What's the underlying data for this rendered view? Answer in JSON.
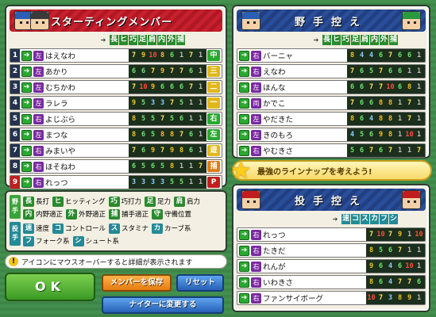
{
  "starting": {
    "title": "スターティングメンバー",
    "headers": [
      "長",
      "ヒ",
      "巧",
      "足",
      "肩",
      "内",
      "外",
      "捕"
    ],
    "rows": [
      {
        "num": "1",
        "hand": "左",
        "name": "はえなわ",
        "stats": [
          "7",
          "9",
          "10",
          "8",
          "6",
          "1",
          "7",
          "1"
        ],
        "pos": "中",
        "pos_color": "#2aa830"
      },
      {
        "num": "2",
        "hand": "左",
        "name": "あかり",
        "stats": [
          "6",
          "6",
          "7",
          "9",
          "7",
          "7",
          "6",
          "1"
        ],
        "pos": "三",
        "pos_color": "#e0b81a"
      },
      {
        "num": "3",
        "hand": "左",
        "name": "むちかわ",
        "stats": [
          "7",
          "10",
          "9",
          "6",
          "6",
          "6",
          "7",
          "1"
        ],
        "pos": "二",
        "pos_color": "#e0b81a"
      },
      {
        "num": "4",
        "hand": "左",
        "name": "ラレラ",
        "stats": [
          "9",
          "5",
          "3",
          "3",
          "7",
          "5",
          "1",
          "1"
        ],
        "pos": "一",
        "pos_color": "#e0b81a"
      },
      {
        "num": "5",
        "hand": "右",
        "name": "よじぶら",
        "stats": [
          "8",
          "5",
          "5",
          "7",
          "5",
          "6",
          "1",
          "1"
        ],
        "pos": "右",
        "pos_color": "#2aa830"
      },
      {
        "num": "6",
        "hand": "左",
        "name": "まつな",
        "stats": [
          "8",
          "6",
          "5",
          "8",
          "8",
          "7",
          "6",
          "1"
        ],
        "pos": "左",
        "pos_color": "#2aa830"
      },
      {
        "num": "7",
        "hand": "右",
        "name": "みまいや",
        "stats": [
          "7",
          "6",
          "9",
          "7",
          "9",
          "8",
          "6",
          "1"
        ],
        "pos": "遊",
        "pos_color": "#e0b81a"
      },
      {
        "num": "8",
        "hand": "右",
        "name": "ほそねわ",
        "stats": [
          "6",
          "5",
          "6",
          "5",
          "8",
          "1",
          "1",
          "7"
        ],
        "pos": "捕",
        "pos_color": "#e07a10"
      },
      {
        "num": "9",
        "hand": "右",
        "name": "れっつ",
        "stats": [
          "3",
          "3",
          "3",
          "3",
          "5",
          "5",
          "1",
          "1"
        ],
        "pos": "P",
        "pos_color": "#c01e1e"
      }
    ]
  },
  "bench": {
    "title": "野手控え",
    "headers": [
      "長",
      "ヒ",
      "巧",
      "足",
      "肩",
      "内",
      "外",
      "捕"
    ],
    "rows": [
      {
        "hand": "右",
        "name": "バーニャ",
        "stats": [
          "8",
          "4",
          "4",
          "6",
          "7",
          "6",
          "6",
          "1"
        ]
      },
      {
        "hand": "右",
        "name": "えなわ",
        "stats": [
          "7",
          "6",
          "5",
          "7",
          "6",
          "6",
          "1",
          "1"
        ]
      },
      {
        "hand": "左",
        "name": "ほんな",
        "stats": [
          "6",
          "6",
          "7",
          "7",
          "10",
          "6",
          "8",
          "1"
        ]
      },
      {
        "hand": "両",
        "name": "かでこ",
        "stats": [
          "7",
          "6",
          "6",
          "8",
          "8",
          "1",
          "7",
          "1"
        ]
      },
      {
        "hand": "左",
        "name": "やだきた",
        "stats": [
          "8",
          "6",
          "4",
          "8",
          "8",
          "1",
          "7",
          "1"
        ]
      },
      {
        "hand": "左",
        "name": "きのもろ",
        "stats": [
          "4",
          "5",
          "6",
          "9",
          "8",
          "1",
          "10",
          "1"
        ]
      },
      {
        "hand": "右",
        "name": "やむきさ",
        "stats": [
          "5",
          "6",
          "7",
          "6",
          "7",
          "1",
          "1",
          "7"
        ]
      }
    ]
  },
  "banner": "最強のラインナップを考えよう!",
  "pitchers": {
    "title": "投手控え",
    "headers": [
      "速",
      "コ",
      "ス",
      "カ",
      "フ",
      "シ"
    ],
    "rows": [
      {
        "hand": "右",
        "name": "れっつ",
        "stats": [
          "7",
          "10",
          "7",
          "9",
          "1",
          "10"
        ]
      },
      {
        "hand": "右",
        "name": "たきだ",
        "stats": [
          "8",
          "5",
          "6",
          "7",
          "1",
          "1"
        ]
      },
      {
        "hand": "右",
        "name": "れんが",
        "stats": [
          "9",
          "6",
          "4",
          "6",
          "10",
          "1"
        ]
      },
      {
        "hand": "右",
        "name": "いわきさ",
        "stats": [
          "8",
          "6",
          "4",
          "7",
          "7",
          "6"
        ]
      },
      {
        "hand": "右",
        "name": "ファンサイボーグ",
        "stats": [
          "10",
          "7",
          "3",
          "8",
          "9",
          "1"
        ]
      }
    ]
  },
  "legend": {
    "fielder_tag": "野手",
    "pitcher_tag": "投手",
    "f1": [
      {
        "t": "長",
        "l": "長打"
      },
      {
        "t": "ヒ",
        "l": "ヒッティング"
      },
      {
        "t": "巧",
        "l": "巧打力"
      },
      {
        "t": "足",
        "l": "足力"
      },
      {
        "t": "肩",
        "l": "肩力"
      }
    ],
    "f2": [
      {
        "t": "内",
        "l": "内野適正"
      },
      {
        "t": "外",
        "l": "外野適正"
      },
      {
        "t": "捕",
        "l": "捕手適正"
      },
      {
        "t": "守",
        "l": "守備位置"
      }
    ],
    "p1": [
      {
        "t": "速",
        "l": "速度"
      },
      {
        "t": "コ",
        "l": "コントロール"
      },
      {
        "t": "ス",
        "l": "スタミナ"
      },
      {
        "t": "カ",
        "l": "カーブ系"
      }
    ],
    "p2": [
      {
        "t": "フ",
        "l": "フォーク系"
      },
      {
        "t": "シ",
        "l": "シュート系"
      }
    ]
  },
  "note": "アイコンにマウスオーバーすると詳細が表示されます",
  "buttons": {
    "ok": "OK",
    "save": "メンバーを保存",
    "reset": "リセット",
    "night": "ナイターに変更する"
  }
}
